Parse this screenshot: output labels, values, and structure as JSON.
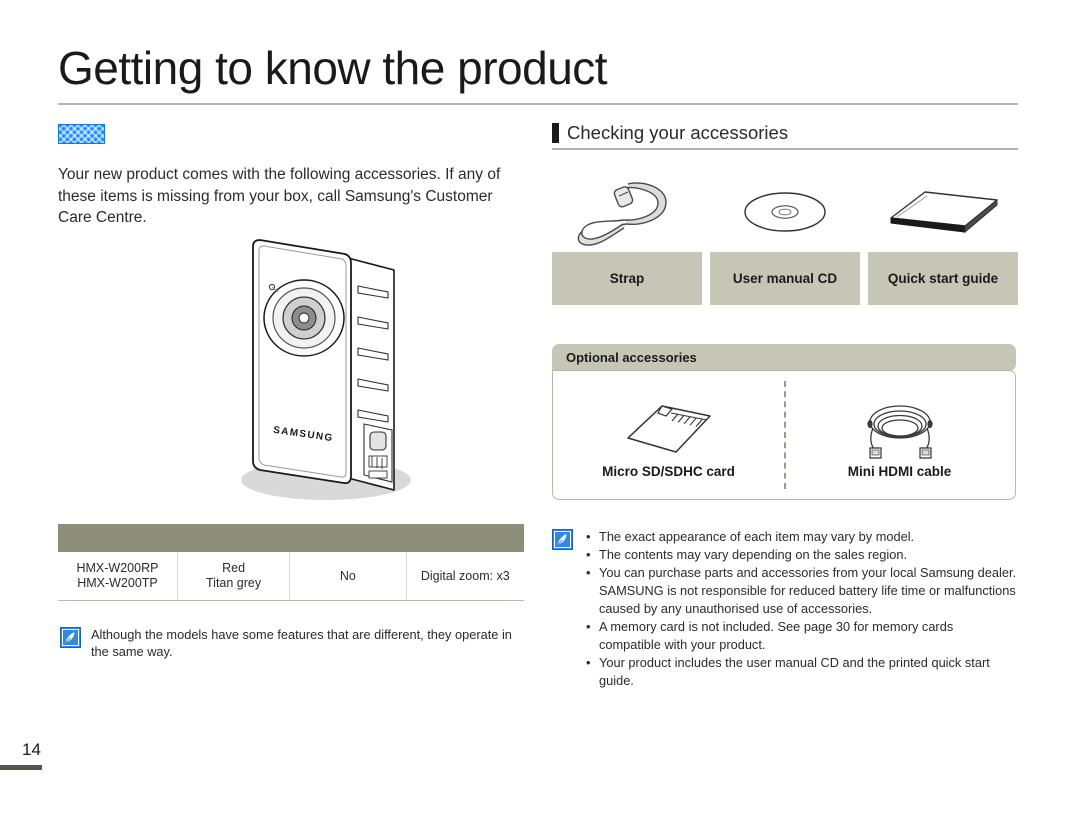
{
  "page": {
    "title": "Getting to know the product",
    "number": "14"
  },
  "left": {
    "redacted_heading": "",
    "intro_text": "Your new product comes with the following accessories. If any of these items is missing from your box, call Samsung's Customer Care Centre.",
    "camcorder_brand": "SAMSUNG",
    "table": {
      "headers": [
        "",
        "",
        "",
        ""
      ],
      "rows": [
        {
          "model": "HMX-W200RP\nHMX-W200TP",
          "colour": "Red\nTitan grey",
          "included": "No",
          "zoom": "Digital zoom: x3"
        }
      ]
    },
    "note": "Although the models have some features that are different, they operate in the same way."
  },
  "right": {
    "section_title": "Checking your accessories",
    "accessories": [
      {
        "label": "Strap",
        "icon": "strap-icon"
      },
      {
        "label": "User manual CD",
        "icon": "cd-disc-icon"
      },
      {
        "label": "Quick start guide",
        "icon": "booklet-icon"
      }
    ],
    "optional": {
      "heading": "Optional accessories",
      "items": [
        {
          "label": "Micro SD/SDHC card",
          "icon": "memory-card-icon"
        },
        {
          "label": "Mini HDMI cable",
          "icon": "hdmi-cable-icon"
        }
      ]
    },
    "notes": [
      "The exact appearance of each item may vary by model.",
      "The contents may vary depending on the sales region.",
      "You can purchase parts and accessories from your local Samsung dealer. SAMSUNG is not responsible for reduced battery life time or malfunctions caused by any unauthorised use of accessories.",
      "A memory card is not included. See page 30 for memory cards compatible with your product.",
      "Your product includes the user manual CD and the printed quick start guide."
    ]
  },
  "colors": {
    "label_box": "#c5c6b6",
    "table_header": "#8d8e78",
    "page_bar": "#55564a",
    "note_icon_blue": "#2f8ae0",
    "redaction_blue": "#1a8cff"
  }
}
